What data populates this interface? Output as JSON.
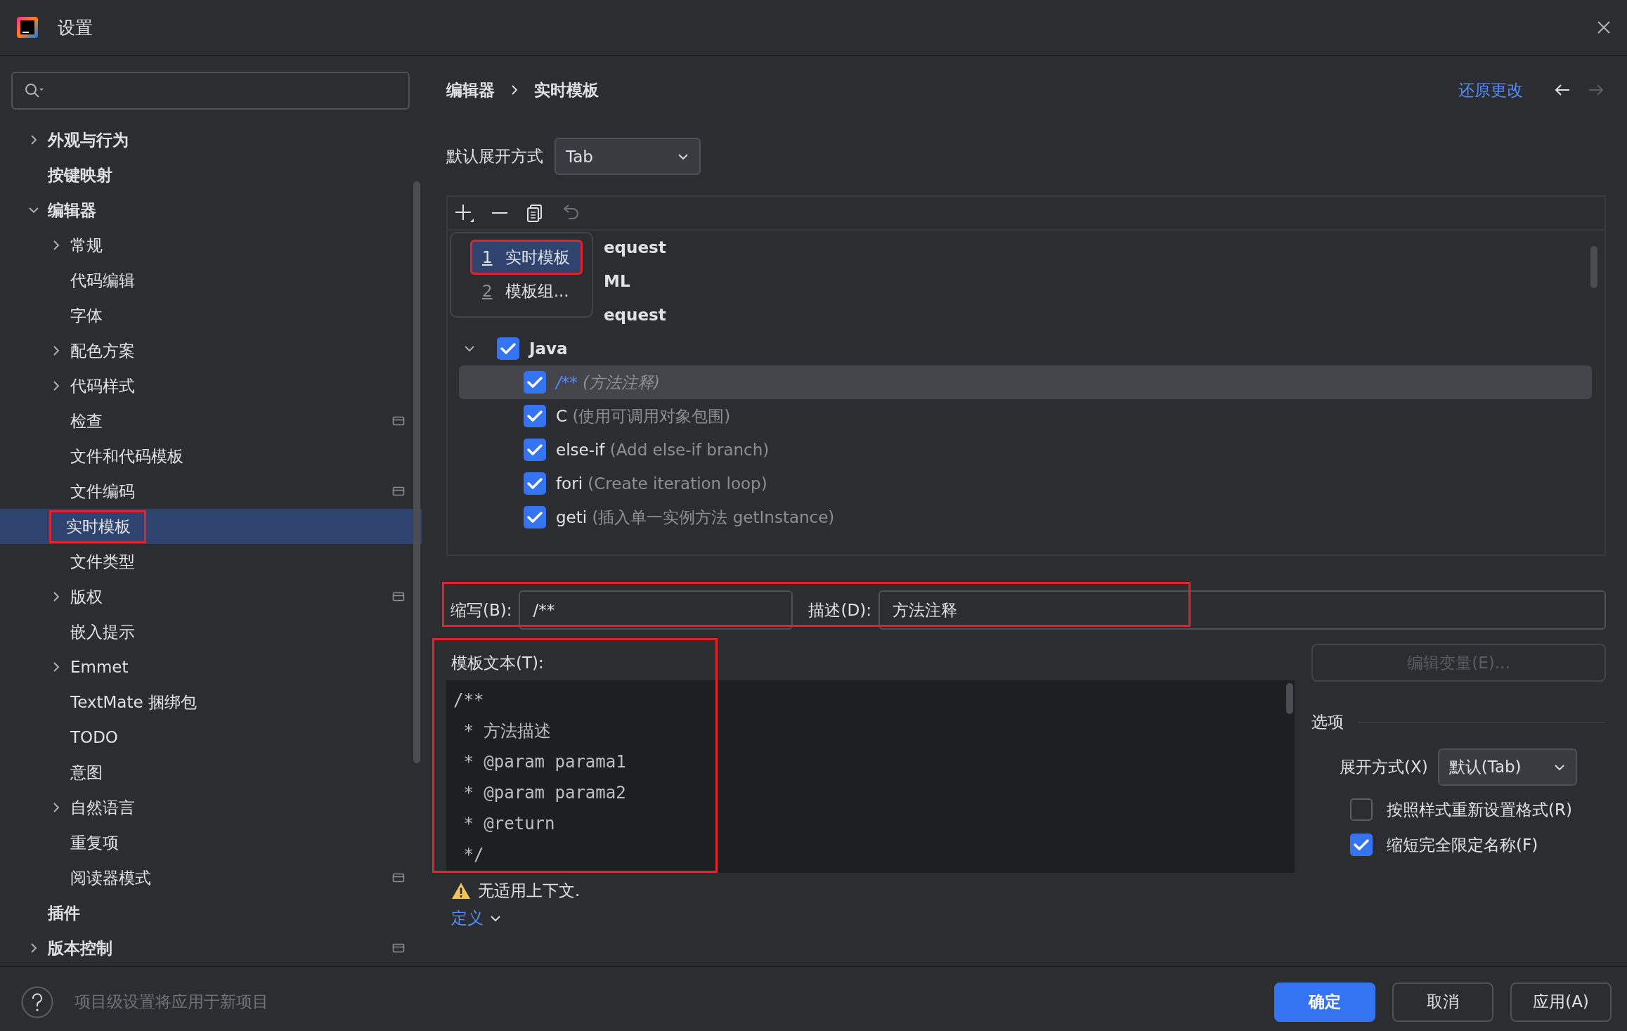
{
  "window": {
    "title": "设置"
  },
  "sidebar": {
    "items": [
      {
        "label": "外观与行为",
        "expanded": false
      },
      {
        "label": "按键映射"
      },
      {
        "label": "编辑器",
        "expanded": true,
        "children": [
          {
            "label": "常规",
            "expanded": false
          },
          {
            "label": "代码编辑"
          },
          {
            "label": "字体"
          },
          {
            "label": "配色方案",
            "expanded": false
          },
          {
            "label": "代码样式",
            "expanded": false
          },
          {
            "label": "检查",
            "project_scope": true
          },
          {
            "label": "文件和代码模板"
          },
          {
            "label": "文件编码",
            "project_scope": true
          },
          {
            "label": "实时模板",
            "selected": true,
            "highlighted": true
          },
          {
            "label": "文件类型"
          },
          {
            "label": "版权",
            "expanded": false,
            "project_scope": true
          },
          {
            "label": "嵌入提示"
          },
          {
            "label": "Emmet",
            "expanded": false
          },
          {
            "label": "TextMate 捆绑包"
          },
          {
            "label": "TODO"
          },
          {
            "label": "意图"
          },
          {
            "label": "自然语言",
            "expanded": false
          },
          {
            "label": "重复项"
          },
          {
            "label": "阅读器模式",
            "project_scope": true
          }
        ]
      },
      {
        "label": "插件"
      },
      {
        "label": "版本控制",
        "expanded": false,
        "project_scope": true
      }
    ]
  },
  "content": {
    "breadcrumb": [
      "编辑器",
      "实时模板"
    ],
    "revert_link": "还原更改",
    "nav": [
      {
        "kind": "back",
        "disabled": false
      },
      {
        "kind": "forward",
        "disabled": true
      }
    ],
    "default_expand": {
      "label": "默认展开方式",
      "value": "Tab"
    },
    "templates": {
      "rows": [
        {
          "kind": "clipped",
          "text": "equest"
        },
        {
          "kind": "clipped",
          "text": "ML"
        },
        {
          "kind": "clipped",
          "text": "equest"
        },
        {
          "kind": "group",
          "text": "Java",
          "checked": true,
          "expanded": true
        },
        {
          "kind": "item",
          "abbreviation": "/**",
          "description": "(方法注释)",
          "checked": true,
          "selected": true
        },
        {
          "kind": "item",
          "abbreviation": "C",
          "description": "(使用可调用对象包围)",
          "checked": true,
          "selected": false
        },
        {
          "kind": "item",
          "abbreviation": "else-if",
          "description": "(Add else-if branch)",
          "checked": true,
          "selected": false
        },
        {
          "kind": "item",
          "abbreviation": "fori",
          "description": "(Create iteration loop)",
          "checked": true,
          "selected": false
        },
        {
          "kind": "item",
          "abbreviation": "geti",
          "description": "(插入单一实例方法 getInstance)",
          "checked": true,
          "selected": false
        }
      ]
    },
    "add_menu": {
      "items": [
        {
          "number": "1",
          "label": "实时模板",
          "selected": true,
          "highlighted": true
        },
        {
          "number": "2",
          "label": "模板组...",
          "selected": false,
          "highlighted": false
        }
      ]
    },
    "fields": {
      "highlighted": true,
      "abbreviation": {
        "label": "缩写(B):",
        "value": "/**"
      },
      "description": {
        "label": "描述(D):",
        "value": "方法注释"
      }
    },
    "template_text": {
      "label": "模板文本(T):",
      "highlighted": true,
      "lines": [
        "/**",
        " * 方法描述",
        " * @param parama1",
        " * @param parama2",
        " * @return",
        " */"
      ]
    },
    "edit_variables_button": {
      "label": "编辑变量(E)...",
      "disabled": true
    },
    "options": {
      "title": "选项",
      "expand_with": {
        "label": "展开方式(X)",
        "value": "默认(Tab)"
      },
      "checkboxes": [
        {
          "label": "按照样式重新设置格式(R)",
          "checked": false
        },
        {
          "label": "缩短完全限定名称(F)",
          "checked": true
        }
      ]
    },
    "warning": "无适用上下文.",
    "context_link": "定义"
  },
  "footer": {
    "hint": "项目级设置将应用于新项目",
    "buttons": [
      {
        "label": "确定",
        "kind": "primary"
      },
      {
        "label": "取消",
        "kind": "normal"
      },
      {
        "label": "应用(A)",
        "kind": "normal"
      }
    ]
  }
}
